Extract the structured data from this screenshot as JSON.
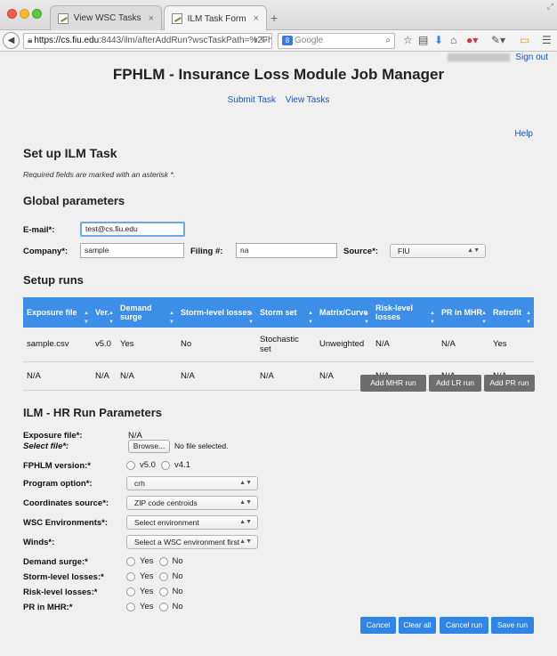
{
  "browser": {
    "tabs": [
      {
        "title": "View WSC Tasks",
        "close": "×"
      },
      {
        "title": "ILM Task Form",
        "close": "×"
      }
    ],
    "new_tab": "+",
    "back": "◀",
    "url_host": "https://cs.fiu.edu",
    "url_rest": ":8443/ilm/afterAddRun?wscTaskPath=%2Fh",
    "search_placeholder": "Google",
    "search_engine": "8"
  },
  "header": {
    "signout": "Sign out",
    "title": "FPHLM - Insurance Loss Module Job Manager",
    "nav": [
      "Submit Task",
      "View Tasks"
    ],
    "help": "Help"
  },
  "setup": {
    "title": "Set up ILM Task",
    "required_note": "Required fields are marked with an asterisk *."
  },
  "global": {
    "title": "Global parameters",
    "email_label": "E-mail*:",
    "email_value": "test@cs.fiu.edu",
    "company_label": "Company*:",
    "company_value": "sample",
    "filing_label": "Filing #:",
    "filing_value": "na",
    "source_label": "Source*:",
    "source_value": "FIU"
  },
  "runs": {
    "title": "Setup runs",
    "columns": [
      "Exposure file",
      "Ver.",
      "Demand surge",
      "Storm-level losses",
      "Storm set",
      "Matrix/Curve",
      "Risk-level losses",
      "PR in MHR",
      "Retrofit"
    ],
    "rows": [
      [
        "sample.csv",
        "v5.0",
        "Yes",
        "No",
        "Stochastic set",
        "Unweighted",
        "N/A",
        "N/A",
        "Yes"
      ],
      [
        "N/A",
        "N/A",
        "N/A",
        "N/A",
        "N/A",
        "N/A",
        "N/A",
        "N/A",
        "N/A"
      ]
    ],
    "buttons": {
      "mhr": "Add MHR run",
      "lr": "Add LR run",
      "pr": "Add PR run"
    }
  },
  "hr": {
    "title": "ILM - HR Run Parameters",
    "exposure_label": "Exposure file*:",
    "exposure_value": "N/A",
    "select_file_label": "Select file*:",
    "browse": "Browse...",
    "no_file": "No file selected.",
    "version_label": "FPHLM version:*",
    "version_options": [
      "v5.0",
      "v4.1"
    ],
    "program_label": "Program option*:",
    "program_value": "crh",
    "coords_label": "Coordinates source*:",
    "coords_value": "ZIP code centroids",
    "wsc_label": "WSC Environments*:",
    "wsc_value": "Select environment",
    "winds_label": "Winds*:",
    "winds_value": "Select a WSC environment first",
    "demand_label": "Demand surge:*",
    "storm_label": "Storm-level losses:*",
    "risk_label": "Risk-level losses:*",
    "pr_label": "PR in MHR:*",
    "yes": "Yes",
    "no": "No",
    "buttons": {
      "cancel": "Cancel",
      "clear": "Clear all",
      "cancel_run": "Cancel run",
      "save": "Save run"
    }
  }
}
